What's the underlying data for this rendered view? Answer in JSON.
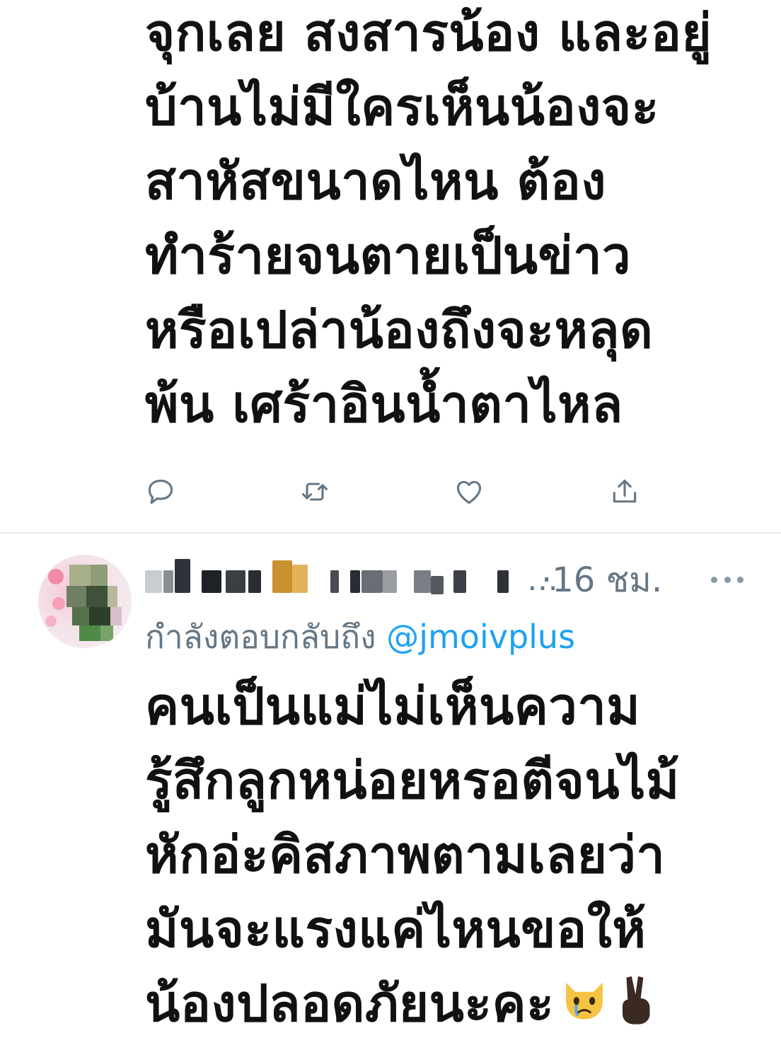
{
  "tweet_top": {
    "lines": [
      "จุกเลย สงสารน้อง และอยู่",
      "บ้านไม่มีใครเห็นน้องจะ",
      "สาหัสขนาดไหน ต้อง",
      "ทำร้ายจนตายเป็นข่าว",
      "หรือเปล่าน้องถึงจะหลุด",
      "พ้น เศร้าอินน้ำตาไหล"
    ],
    "actions": [
      {
        "icon": "reply-icon"
      },
      {
        "icon": "retweet-icon"
      },
      {
        "icon": "like-icon"
      },
      {
        "icon": "share-icon"
      }
    ]
  },
  "tweet_bottom": {
    "display_name_truncation": "…",
    "timestamp": "·16 ชม.",
    "reply_label": "กำลังตอบกลับถึง",
    "reply_mention": "@jmoivplus",
    "lines": [
      "คนเป็นแม่ไม่เห็นความ",
      "รู้สึกลูกหน่อยหรอตีจนไม้",
      "หักอ่ะคิสภาพตามเลยว่า",
      "มันจะแรงแค่ไหนขอให้",
      "น้องปลอดภัยนะคะ"
    ],
    "emojis": [
      "crying-cat-emoji",
      "victory-hand-emoji"
    ]
  },
  "colors": {
    "text": "#111111",
    "secondary": "#657786",
    "link": "#1da1f2",
    "icon": "#657786",
    "divider": "#e6ecf0"
  }
}
